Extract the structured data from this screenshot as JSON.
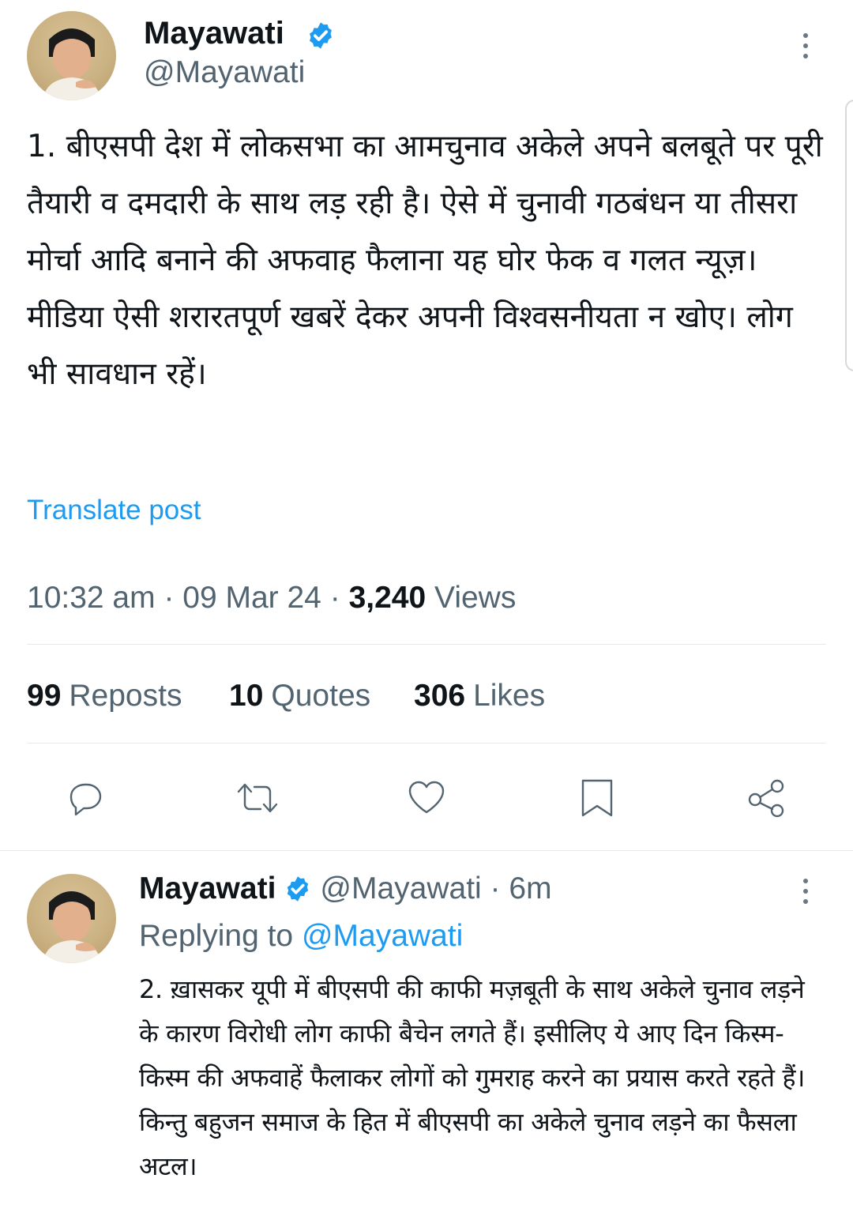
{
  "main_post": {
    "author_name": "Mayawati",
    "author_handle": "@Mayawati",
    "text": "1. बीएसपी देश में लोकसभा का आमचुनाव अकेले अपने बलबूते पर पूरी तैयारी व दमदारी के साथ लड़ रही है। ऐसे में चुनावी गठबंधन या तीसरा मोर्चा आदि बनाने की अफवाह फैलाना यह घोर फेक व गलत न्यूज़। मीडिया ऐसी शरारतपूर्ण खबरें देकर अपनी विश्वसनीयता न खोए। लोग भी सावधान रहें।",
    "translate_label": "Translate post",
    "time": "10:32 am",
    "date": "09 Mar 24",
    "views_count": "3,240",
    "views_label": "Views",
    "reposts_count": "99",
    "reposts_label": "Reposts",
    "quotes_count": "10",
    "quotes_label": "Quotes",
    "likes_count": "306",
    "likes_label": "Likes"
  },
  "reply_post": {
    "author_name": "Mayawati",
    "author_handle": "@Mayawati",
    "age": "6m",
    "replying_prefix": "Replying to",
    "replying_handle": "@Mayawati",
    "text": "2. ख़ासकर यूपी में बीएसपी की काफी मज़बूती के साथ अकेले चुनाव लड़ने के कारण विरोधी लोग काफी बैचेन लगते हैं। इसीलिए ये आए दिन किस्म-किस्म की अफवाहें फैलाकर लोगों को गुमराह करने का प्रयास करते रहते हैं। किन्तु बहुजन समाज के हित में बीएसपी का अकेले चुनाव लड़ने का फैसला अटल।"
  },
  "colors": {
    "link": "#1d9bf0",
    "verified": "#1d9bf0",
    "secondary_text": "#536471",
    "divider": "#e6e9ec"
  },
  "icons": [
    "verified-badge-icon",
    "more-icon",
    "reply-icon",
    "retweet-icon",
    "like-icon",
    "bookmark-icon",
    "share-icon"
  ]
}
